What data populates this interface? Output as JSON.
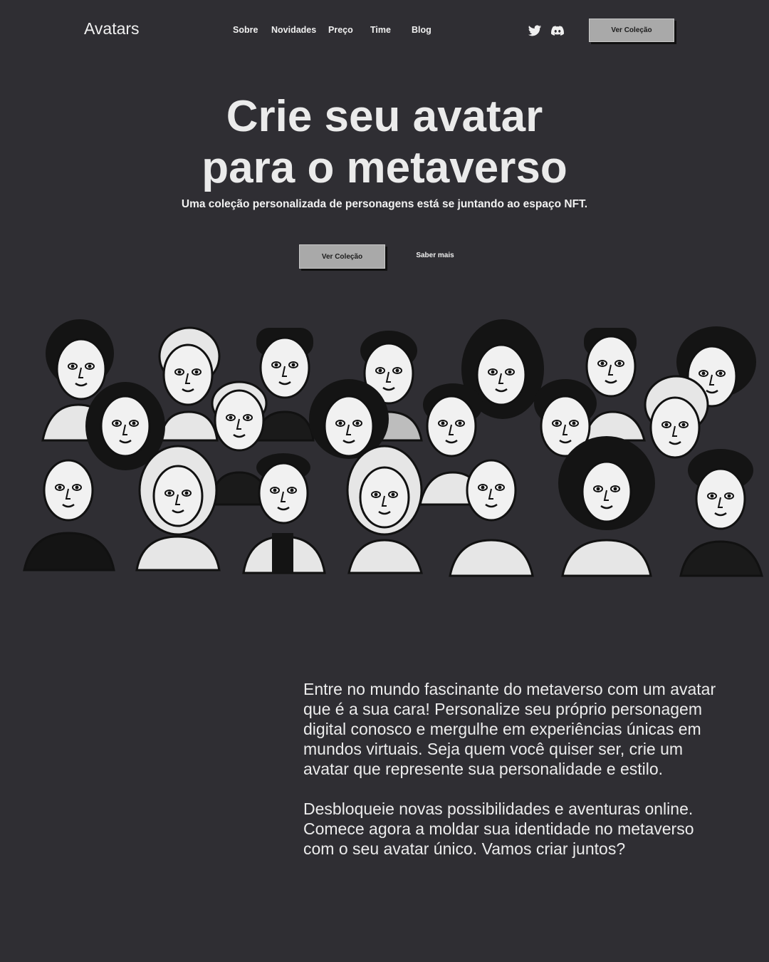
{
  "header": {
    "logo": "Avatars",
    "nav": [
      "Sobre",
      "Novidades",
      "Preço",
      "Time",
      "Blog"
    ],
    "social_icons": [
      "twitter-icon",
      "discord-icon"
    ],
    "cta_label": "Ver Coleção"
  },
  "hero": {
    "title_line1": "Crie seu avatar",
    "title_line2": "para o metaverso",
    "subtitle": "Uma coleção personalizada de personagens está se juntando ao espaço NFT.",
    "primary_cta": "Ver Coleção",
    "secondary_cta": "Saber mais"
  },
  "body": {
    "paragraph1": "Entre no mundo fascinante do metaverso com um avatar que é a sua cara!  Personalize seu próprio personagem digital conosco e mergulhe em experiências únicas em mundos virtuais. Seja quem você quiser ser, crie um avatar que represente sua personalidade e estilo.",
    "paragraph2": "Desbloqueie novas possibilidades e aventuras online. Comece agora a moldar sua identidade no metaverso com o seu avatar único. Vamos criar juntos?"
  },
  "colors": {
    "background": "#2f2e33",
    "button": "#a9a9a9",
    "text": "#ececec"
  }
}
